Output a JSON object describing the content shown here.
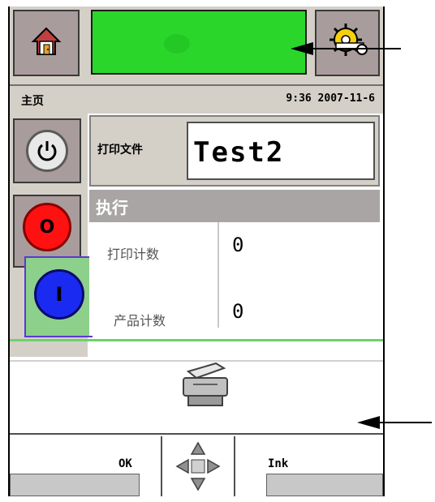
{
  "topbar": {
    "home_icon": "home-icon",
    "settings_icon": "gear-wrench-icon",
    "status_color": "#2bd62b"
  },
  "infobar": {
    "page_title": "主页",
    "datetime": "9:36 2007-11-6"
  },
  "controls": {
    "power_icon": "power-icon",
    "stop_label": "O",
    "start_label": "I"
  },
  "print_file": {
    "label": "打印文件",
    "filename": "Test2"
  },
  "execution": {
    "header": "执行",
    "rows": [
      {
        "label": "打印计数",
        "value": "0"
      },
      {
        "label": "产品计数",
        "value": "0"
      }
    ]
  },
  "footer": {
    "ok_label": "OK",
    "ink_label": "Ink",
    "nav_icon": "nav-arrows-icon",
    "printer_icon": "printer-icon"
  }
}
